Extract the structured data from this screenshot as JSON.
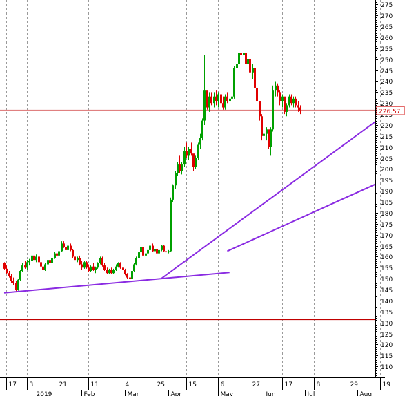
{
  "chart_data": {
    "type": "candlestick",
    "price_label": "226.57",
    "colors": {
      "up": "#00a000",
      "down": "#e00000",
      "grid": "#9a9a9a",
      "hline": "#c00000",
      "trendline": "#8a2be2",
      "axis": "#000000",
      "price_box_border": "#d00000",
      "price_text": "#d00000"
    },
    "y_axis": {
      "min": 105,
      "max": 277,
      "ticks": [
        110,
        115,
        120,
        125,
        130,
        135,
        140,
        145,
        150,
        155,
        160,
        165,
        170,
        175,
        180,
        185,
        190,
        195,
        200,
        205,
        210,
        215,
        220,
        225,
        230,
        235,
        240,
        245,
        250,
        255,
        260,
        265,
        270,
        275
      ]
    },
    "x_axis": {
      "day_ticks": [
        {
          "label": "17",
          "index": 1
        },
        {
          "label": "3",
          "index": 10
        },
        {
          "label": "21",
          "index": 23
        },
        {
          "label": "11",
          "index": 37
        },
        {
          "label": "4",
          "index": 52
        },
        {
          "label": "25",
          "index": 66
        },
        {
          "label": "15",
          "index": 80
        },
        {
          "label": "6",
          "index": 94
        },
        {
          "label": "27",
          "index": 108
        },
        {
          "label": "17",
          "index": 122
        },
        {
          "label": "8",
          "index": 136
        },
        {
          "label": "29",
          "index": 151
        },
        {
          "label": "19",
          "index": 165
        }
      ],
      "month_labels": [
        {
          "label": "2019",
          "index": 13
        },
        {
          "label": "Feb",
          "index": 34
        },
        {
          "label": "Mar",
          "index": 53
        },
        {
          "label": "Apr",
          "index": 72
        },
        {
          "label": "May",
          "index": 94
        },
        {
          "label": "Jun",
          "index": 114
        },
        {
          "label": "Jul",
          "index": 132
        },
        {
          "label": "Aug",
          "index": 155
        }
      ]
    },
    "horizontal_lines": [
      {
        "value": 226.8,
        "color": "#e08080"
      },
      {
        "value": 131.5,
        "color": "#c00000"
      }
    ],
    "trendlines": [
      {
        "from": {
          "index": 0,
          "value": 143.5
        },
        "to": {
          "index": 99,
          "value": 152.8
        }
      },
      {
        "from": {
          "index": 69,
          "value": 150
        },
        "to": {
          "index": 163,
          "value": 221.5
        }
      },
      {
        "from": {
          "index": 98,
          "value": 162.5
        },
        "to": {
          "index": 163,
          "value": 193
        }
      }
    ],
    "candles": [
      [
        0,
        157,
        157.5,
        154,
        154.5
      ],
      [
        1,
        154.5,
        156,
        152,
        152.5
      ],
      [
        2,
        152.5,
        153.5,
        150.5,
        151
      ],
      [
        3,
        151,
        152,
        148,
        149
      ],
      [
        4,
        149,
        150.5,
        147,
        148
      ],
      [
        5,
        148,
        149,
        144,
        145
      ],
      [
        6,
        145,
        150,
        144.5,
        149.5
      ],
      [
        7,
        149.5,
        154,
        149,
        153.5
      ],
      [
        8,
        153.5,
        157,
        153,
        156
      ],
      [
        9,
        156,
        158,
        154.5,
        155
      ],
      [
        10,
        155,
        158.5,
        154,
        157.5
      ],
      [
        11,
        157.5,
        159,
        156,
        158
      ],
      [
        12,
        158,
        161,
        157.5,
        160.5
      ],
      [
        13,
        160.5,
        162,
        158,
        158.5
      ],
      [
        14,
        158.5,
        161,
        157.5,
        160
      ],
      [
        15,
        160,
        162,
        157,
        157.5
      ],
      [
        16,
        157.5,
        158.5,
        155,
        155.5
      ],
      [
        17,
        155.5,
        157.5,
        153,
        154
      ],
      [
        18,
        154,
        157,
        153.5,
        156.5
      ],
      [
        19,
        156.5,
        159,
        156,
        158.5
      ],
      [
        20,
        158.5,
        159.5,
        156.5,
        157
      ],
      [
        21,
        157,
        160,
        156.5,
        159.5
      ],
      [
        22,
        159.5,
        162,
        159,
        161.5
      ],
      [
        23,
        161.5,
        163,
        160,
        160.5
      ],
      [
        24,
        160.5,
        163,
        159.5,
        162.5
      ],
      [
        25,
        162.5,
        167,
        162,
        166
      ],
      [
        26,
        166,
        167,
        164,
        164.5
      ],
      [
        27,
        164.5,
        166,
        162.5,
        163
      ],
      [
        28,
        163,
        165.5,
        162,
        165
      ],
      [
        29,
        165,
        166,
        162.5,
        163
      ],
      [
        30,
        163,
        163.5,
        159.5,
        160
      ],
      [
        31,
        160,
        161,
        158,
        158.5
      ],
      [
        32,
        158.5,
        160,
        157.5,
        159.5
      ],
      [
        33,
        159.5,
        160.5,
        156,
        156.5
      ],
      [
        34,
        156.5,
        158,
        154,
        155
      ],
      [
        35,
        155,
        158,
        154.5,
        157.5
      ],
      [
        36,
        157.5,
        158,
        154.5,
        155
      ],
      [
        37,
        155,
        156.5,
        153,
        153.5
      ],
      [
        38,
        153.5,
        156,
        153,
        155.5
      ],
      [
        39,
        155.5,
        157,
        153.5,
        154
      ],
      [
        40,
        154,
        155.5,
        152.5,
        155
      ],
      [
        41,
        155,
        157.5,
        154.5,
        157
      ],
      [
        42,
        157,
        160,
        156.5,
        159.5
      ],
      [
        43,
        159.5,
        160,
        155.5,
        156
      ],
      [
        44,
        156,
        157,
        153.5,
        154
      ],
      [
        45,
        154,
        155,
        152,
        152.5
      ],
      [
        46,
        152.5,
        154.5,
        152,
        154
      ],
      [
        47,
        154,
        155,
        152,
        152.5
      ],
      [
        48,
        152.5,
        154.5,
        152,
        154
      ],
      [
        49,
        154,
        156.5,
        153.5,
        155.5
      ],
      [
        50,
        155.5,
        157.5,
        155,
        157
      ],
      [
        51,
        157,
        157.5,
        154.5,
        155
      ],
      [
        52,
        155,
        156.5,
        153.5,
        154
      ],
      [
        53,
        154,
        154.5,
        151.5,
        152
      ],
      [
        54,
        152,
        152.5,
        150,
        150.5
      ],
      [
        55,
        150.5,
        151,
        149.5,
        150
      ],
      [
        56,
        150,
        154,
        149.5,
        153.5
      ],
      [
        57,
        153.5,
        157,
        153,
        156.5
      ],
      [
        58,
        156.5,
        160,
        156,
        159.5
      ],
      [
        59,
        159.5,
        162.5,
        159,
        162
      ],
      [
        60,
        162,
        165,
        161.5,
        164.5
      ],
      [
        61,
        164.5,
        165,
        160,
        160.5
      ],
      [
        62,
        160.5,
        162,
        159,
        161.5
      ],
      [
        63,
        161.5,
        163.5,
        160.5,
        163
      ],
      [
        64,
        163,
        165.5,
        162,
        165
      ],
      [
        65,
        165,
        166,
        162,
        162.5
      ],
      [
        66,
        162.5,
        164,
        161.5,
        163.5
      ],
      [
        67,
        163.5,
        164.5,
        161,
        161.5
      ],
      [
        68,
        161.5,
        164,
        161,
        163
      ],
      [
        69,
        163,
        165.5,
        162.5,
        165
      ],
      [
        70,
        165,
        165.5,
        162,
        162.5
      ],
      [
        71,
        162.5,
        163,
        161.5,
        162
      ],
      [
        72,
        162,
        163,
        161.5,
        162.5
      ],
      [
        73,
        162.5,
        187,
        162,
        186
      ],
      [
        74,
        186,
        193,
        185,
        192.5
      ],
      [
        75,
        192.5,
        199,
        191,
        198
      ],
      [
        76,
        198,
        203,
        197,
        202
      ],
      [
        77,
        202,
        206,
        198,
        199
      ],
      [
        78,
        199,
        203,
        197.5,
        202
      ],
      [
        79,
        202,
        210,
        201,
        208
      ],
      [
        80,
        208,
        212,
        205,
        206
      ],
      [
        81,
        206,
        210,
        204,
        209
      ],
      [
        82,
        209,
        212,
        206,
        207
      ],
      [
        83,
        207,
        206,
        199,
        201
      ],
      [
        84,
        201,
        206,
        200,
        205
      ],
      [
        85,
        205,
        212,
        204,
        211
      ],
      [
        86,
        211,
        216,
        209,
        214
      ],
      [
        87,
        214,
        223,
        213,
        222
      ],
      [
        88,
        222,
        252,
        220,
        236
      ],
      [
        89,
        236,
        234,
        227,
        228
      ],
      [
        90,
        228,
        235,
        226,
        233
      ],
      [
        91,
        233,
        235,
        229,
        230
      ],
      [
        92,
        230,
        235,
        228,
        233
      ],
      [
        93,
        233,
        236,
        229,
        231
      ],
      [
        94,
        231,
        235,
        228,
        234
      ],
      [
        95,
        234,
        236,
        229,
        230
      ],
      [
        96,
        230,
        233,
        227,
        228
      ],
      [
        97,
        228,
        234,
        227,
        233
      ],
      [
        98,
        233,
        235,
        230,
        231
      ],
      [
        99,
        231,
        233,
        229,
        232
      ],
      [
        100,
        232,
        234,
        230,
        233
      ],
      [
        101,
        233,
        247,
        232,
        246
      ],
      [
        102,
        246,
        249,
        243,
        248
      ],
      [
        103,
        248,
        254,
        247,
        253
      ],
      [
        104,
        253,
        256,
        251,
        252
      ],
      [
        105,
        252,
        255,
        249,
        253
      ],
      [
        106,
        253,
        254,
        247,
        248
      ],
      [
        107,
        248,
        252,
        245,
        250
      ],
      [
        108,
        250,
        252,
        243,
        244
      ],
      [
        109,
        244,
        248,
        241,
        246
      ],
      [
        110,
        246,
        245,
        235,
        237
      ],
      [
        111,
        237,
        236,
        229,
        231
      ],
      [
        112,
        231,
        230,
        222,
        224
      ],
      [
        113,
        224,
        225,
        213,
        215
      ],
      [
        114,
        215,
        217,
        212,
        216
      ],
      [
        115,
        216,
        219,
        213,
        218
      ],
      [
        116,
        218,
        217,
        209,
        210
      ],
      [
        117,
        210,
        219,
        206,
        218
      ],
      [
        118,
        218,
        238,
        217,
        236
      ],
      [
        119,
        236,
        240,
        233,
        238
      ],
      [
        120,
        238,
        239,
        233,
        235
      ],
      [
        121,
        235,
        236,
        229,
        231
      ],
      [
        122,
        231,
        234,
        228,
        233
      ],
      [
        123,
        233,
        232,
        225,
        226
      ],
      [
        124,
        226,
        230,
        224,
        229
      ],
      [
        125,
        229,
        234,
        228,
        233
      ],
      [
        126,
        233,
        234,
        229,
        230
      ],
      [
        127,
        230,
        233,
        228,
        232
      ],
      [
        128,
        232,
        233,
        228,
        229
      ],
      [
        129,
        229,
        231,
        226,
        228
      ],
      [
        130,
        228,
        229,
        225,
        226.57
      ]
    ]
  }
}
